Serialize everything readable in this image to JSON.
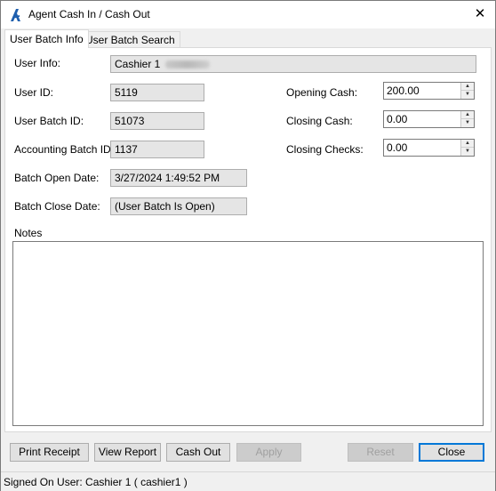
{
  "window": {
    "title": "Agent Cash In / Cash Out",
    "close_glyph": "✕",
    "icon": "app-logo-icon"
  },
  "tabs": [
    {
      "label": "User Batch Info",
      "active": true
    },
    {
      "label": "User Batch Search",
      "active": false
    }
  ],
  "form": {
    "user_info": {
      "label": "User Info:",
      "value": "Cashier 1"
    },
    "user_id": {
      "label": "User ID:",
      "value": "5119"
    },
    "user_batch_id": {
      "label": "User Batch ID:",
      "value": "51073"
    },
    "accounting_batch_id": {
      "label": "Accounting Batch ID:",
      "value": "1137"
    },
    "batch_open_date": {
      "label": "Batch Open Date:",
      "value": "3/27/2024 1:49:52 PM"
    },
    "batch_close_date": {
      "label": "Batch Close Date:",
      "value": "(User Batch Is Open)"
    },
    "opening_cash": {
      "label": "Opening Cash:",
      "value": "200.00"
    },
    "closing_cash": {
      "label": "Closing Cash:",
      "value": "0.00"
    },
    "closing_checks": {
      "label": "Closing Checks:",
      "value": "0.00"
    },
    "notes": {
      "label": "Notes",
      "value": ""
    }
  },
  "buttons": {
    "print_receipt": "Print Receipt",
    "view_report": "View Report",
    "cash_out": "Cash Out",
    "apply": "Apply",
    "reset": "Reset",
    "close": "Close"
  },
  "status": {
    "text": "Signed On User: Cashier 1 ( cashier1 )"
  },
  "colors": {
    "accent": "#0078d7",
    "logo": "#1f5fae",
    "readonly_bg": "#e5e5e5"
  }
}
